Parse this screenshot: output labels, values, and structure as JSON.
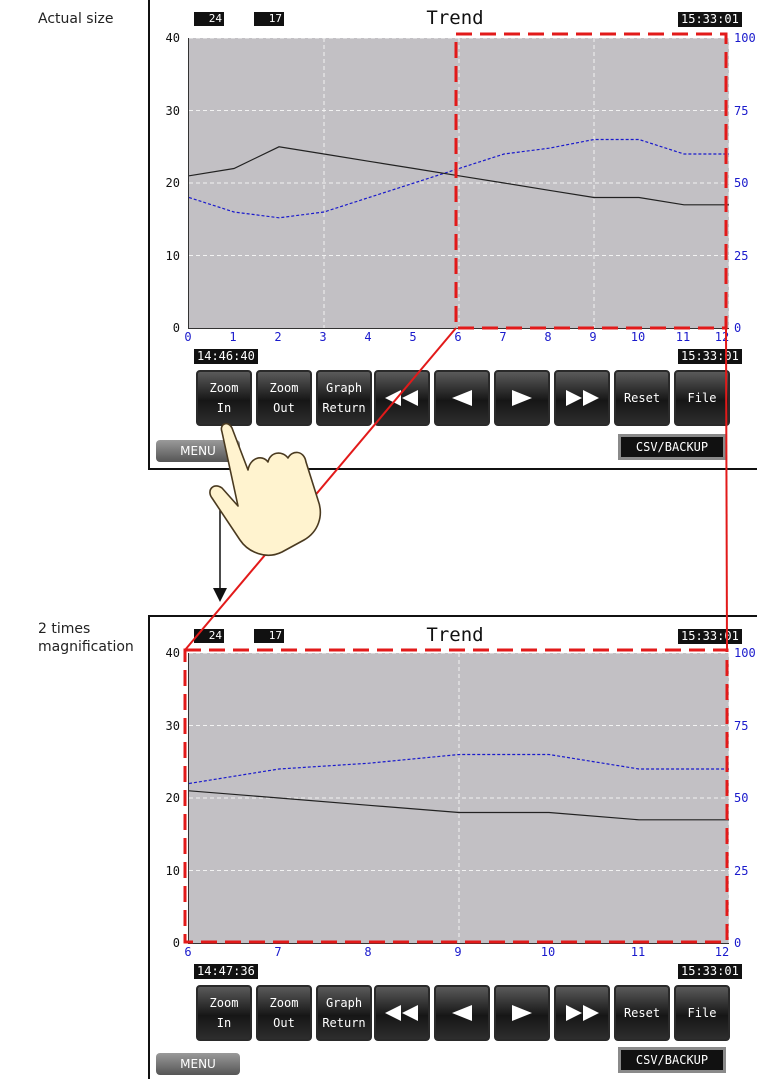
{
  "captions": {
    "actual": "Actual size",
    "magnified_line1": "2 times",
    "magnified_line2": "magnification"
  },
  "top": {
    "header_left_a": "24",
    "header_left_b": "17",
    "title": "Trend",
    "clock_top": "15:33:01",
    "start_time": "14:46:40",
    "end_time": "15:33:01",
    "y_ticks": [
      "40",
      "30",
      "20",
      "10",
      "0"
    ],
    "y2_ticks": [
      "100",
      "75",
      "50",
      "25",
      "0"
    ],
    "x_ticks": [
      "0",
      "1",
      "2",
      "3",
      "4",
      "5",
      "6",
      "7",
      "8",
      "9",
      "10",
      "11",
      "12"
    ]
  },
  "bottom": {
    "header_left_a": "24",
    "header_left_b": "17",
    "title": "Trend",
    "clock_top": "15:33:01",
    "start_time": "14:47:36",
    "end_time": "15:33:01",
    "y_ticks": [
      "40",
      "30",
      "20",
      "10",
      "0"
    ],
    "y2_ticks": [
      "100",
      "75",
      "50",
      "25",
      "0"
    ],
    "x_ticks": [
      "6",
      "7",
      "8",
      "9",
      "10",
      "11",
      "12"
    ]
  },
  "buttons": {
    "zoom_in_1": "Zoom",
    "zoom_in_2": "In",
    "zoom_out_1": "Zoom",
    "zoom_out_2": "Out",
    "graph_return_1": "Graph",
    "graph_return_2": "Return",
    "reset": "Reset",
    "file": "File",
    "menu": "MENU",
    "csv_backup": "CSV/BACKUP"
  },
  "series": {
    "x": [
      0,
      1,
      2,
      3,
      4,
      5,
      6,
      7,
      8,
      9,
      10,
      11,
      12
    ],
    "black_left_axis": [
      21,
      22,
      25,
      24,
      23,
      22,
      21,
      20,
      19,
      18,
      18,
      17,
      17
    ],
    "blue_right_axis": [
      45,
      40,
      38,
      40,
      45,
      50,
      55,
      60,
      62,
      65,
      65,
      60,
      60
    ]
  },
  "colors": {
    "plot_bg": "#c2c0c4",
    "black_series": "#222222",
    "blue_series": "#1a1acc",
    "highlight": "#e21a1a",
    "pointer_line": "#e21a1a"
  },
  "icons": {
    "fast_rewind": "fast-rewind-icon",
    "step_back": "step-back-icon",
    "step_forward": "step-forward-icon",
    "fast_forward": "fast-forward-icon",
    "pointing_hand": "pointing-hand-icon"
  }
}
